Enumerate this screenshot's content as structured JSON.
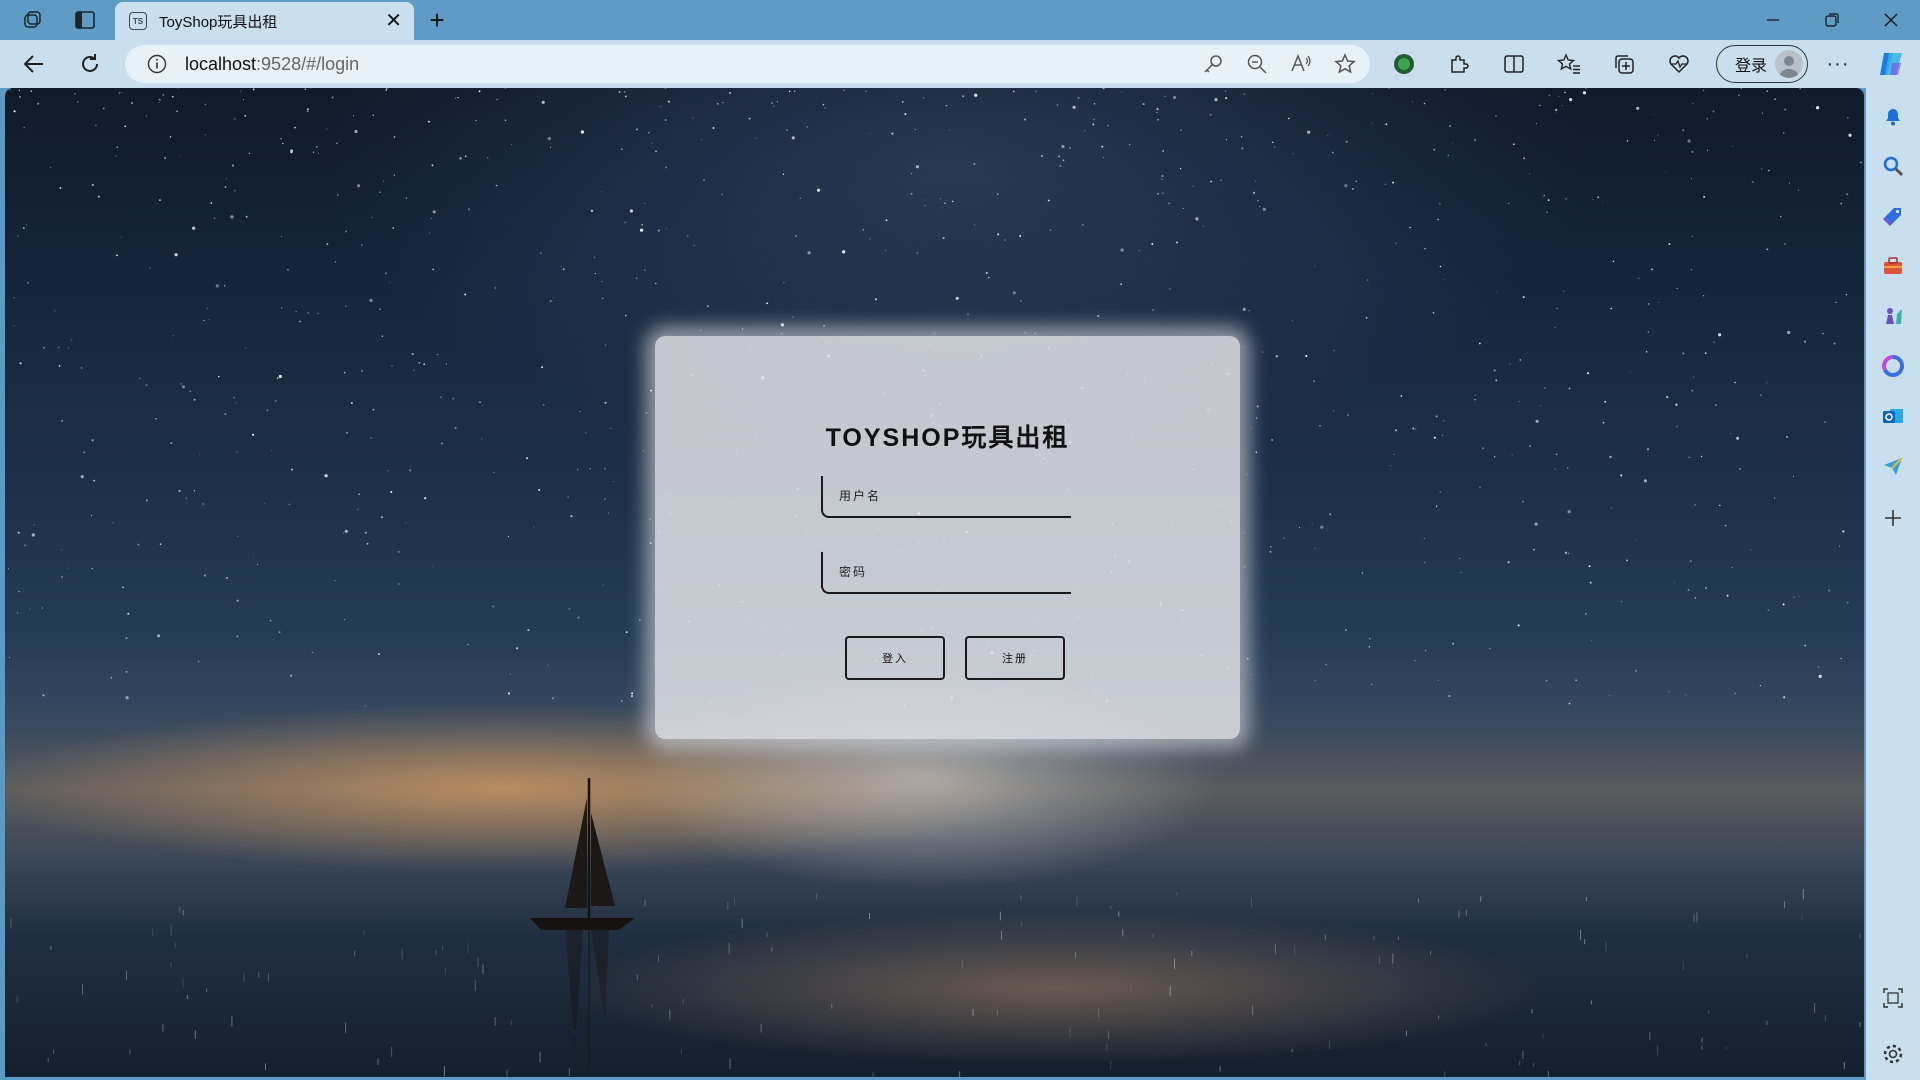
{
  "browser": {
    "tab": {
      "title": "ToyShop玩具出租",
      "favicon_text": "TS",
      "close": "✕"
    },
    "new_tab": "+",
    "address": {
      "host": "localhost",
      "rest": ":9528/#/login"
    },
    "profile_button": "登录",
    "more": "···",
    "icons": {
      "workspaces": "workspaces-icon",
      "tab-actions": "tab-actions-icon",
      "back": "back-icon",
      "refresh": "refresh-icon",
      "info": "info-icon",
      "password": "key-icon",
      "zoom": "zoom-out-icon",
      "read-aloud": "read-aloud-icon",
      "favorite": "star-icon",
      "extension-green": "extension-icon",
      "extensions": "puzzle-icon",
      "split": "split-screen-icon",
      "favorites": "favorites-icon",
      "collections": "collections-icon",
      "performance": "heart-icon",
      "copilot": "copilot-icon"
    },
    "sidebar_icons": [
      "bell-icon",
      "search-icon",
      "tag-icon",
      "toolbox-icon",
      "chess-icon",
      "microsoft365-icon",
      "outlook-icon",
      "send-icon",
      "add-icon",
      "screenshot-icon",
      "settings-icon"
    ]
  },
  "login": {
    "title": "TOYSHOP玩具出租",
    "username_placeholder": "用户名",
    "username_value": "",
    "password_placeholder": "密码",
    "password_value": "",
    "login_button": "登入",
    "register_button": "注册"
  }
}
